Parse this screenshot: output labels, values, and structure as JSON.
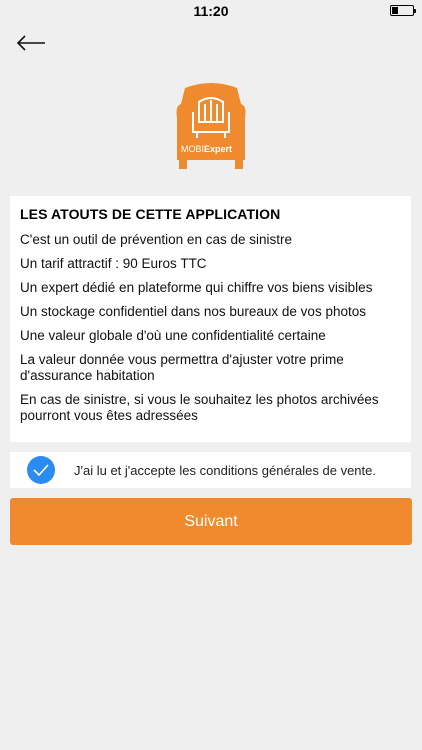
{
  "status_bar": {
    "time": "11:20"
  },
  "header": {
    "back_icon": "arrow-left-icon"
  },
  "logo": {
    "text_a": "MOBI",
    "text_b": "Expert",
    "icon": "armchair-icon"
  },
  "features": {
    "title": "LES ATOUTS DE CETTE APPLICATION",
    "items": [
      "C'est un outil de prévention en cas de sinistre",
      "Un tarif attractif : 90 Euros TTC",
      "Un expert dédié en plateforme qui chiffre vos biens visibles",
      "Un stockage confidentiel dans nos bureaux de vos photos",
      "Une valeur globale d'où une confidentialité certaine",
      "La valeur donnée vous permettra d'ajuster votre prime d'assurance habitation",
      "En cas de sinistre, si vous le souhaitez les photos archivées pourront vous êtes adressées"
    ]
  },
  "terms": {
    "checked": true,
    "label": "J'ai lu et j'accepte les conditions générales de vente."
  },
  "next_button": {
    "label": "Suivant"
  },
  "colors": {
    "accent": "#f08a2e",
    "check": "#2a8cf0",
    "background": "#efefef"
  }
}
